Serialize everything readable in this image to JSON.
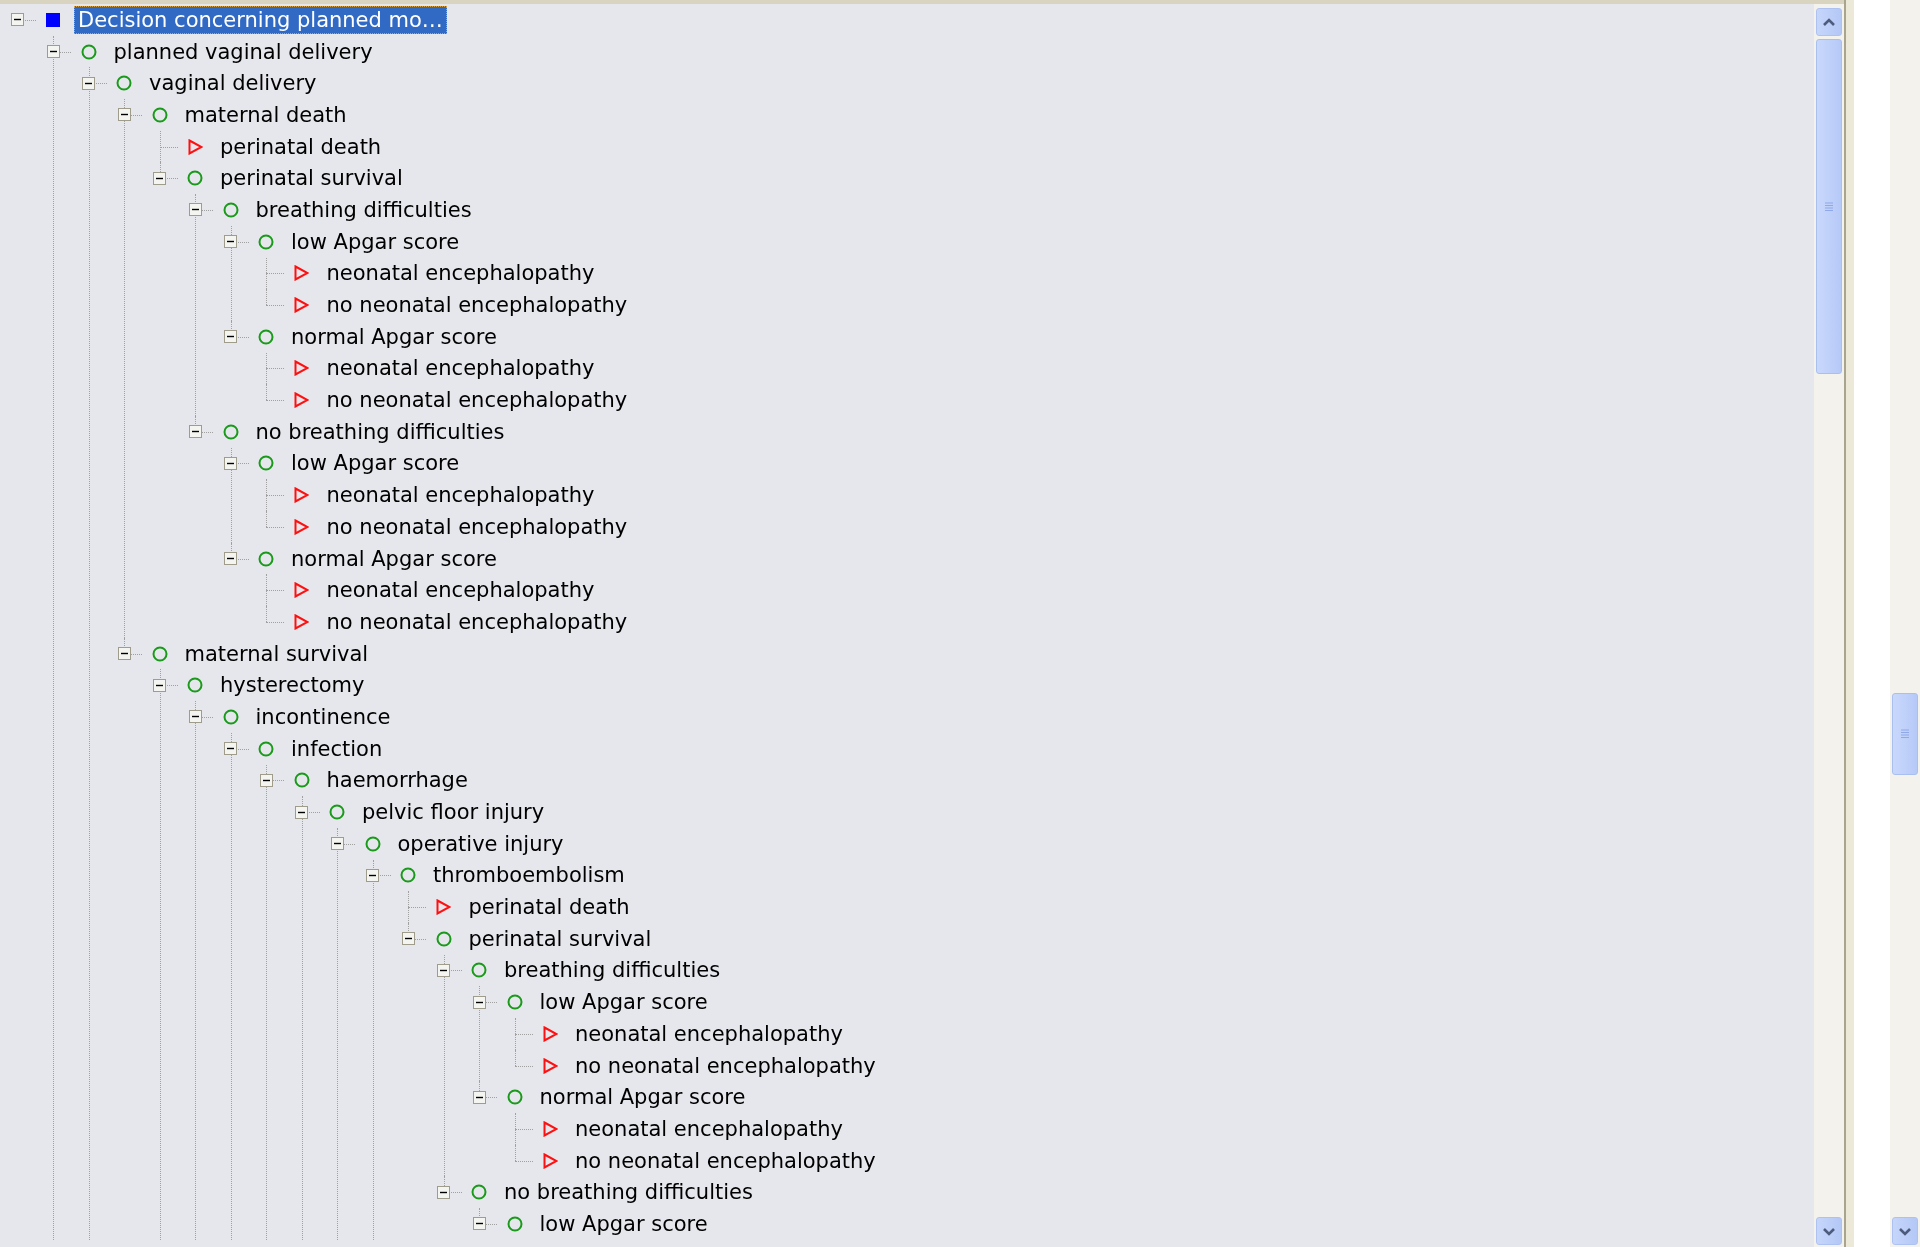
{
  "tree": {
    "root": {
      "label": "Decision concerning planned mo…",
      "kind": "decision",
      "selected": true,
      "expanded": true,
      "children": [
        {
          "label": "planned vaginal delivery",
          "kind": "chance",
          "selected": false,
          "expanded": true,
          "more_siblings_below": true,
          "children": [
            {
              "label": "vaginal delivery",
              "kind": "chance",
              "selected": false,
              "expanded": true,
              "more_siblings_below": true,
              "children": [
                {
                  "label": "maternal death",
                  "kind": "chance",
                  "selected": false,
                  "expanded": true,
                  "children": [
                    {
                      "label": "perinatal death",
                      "kind": "terminal",
                      "selected": false
                    },
                    {
                      "label": "perinatal survival",
                      "kind": "chance",
                      "selected": false,
                      "expanded": true,
                      "children": [
                        {
                          "label": "breathing difficulties",
                          "kind": "chance",
                          "selected": false,
                          "expanded": true,
                          "children": [
                            {
                              "label": "low Apgar score",
                              "kind": "chance",
                              "selected": false,
                              "expanded": true,
                              "children": [
                                {
                                  "label": "neonatal encephalopathy",
                                  "kind": "terminal",
                                  "selected": false
                                },
                                {
                                  "label": "no neonatal encephalopathy",
                                  "kind": "terminal",
                                  "selected": false
                                }
                              ]
                            },
                            {
                              "label": "normal Apgar score",
                              "kind": "chance",
                              "selected": false,
                              "expanded": true,
                              "children": [
                                {
                                  "label": "neonatal encephalopathy",
                                  "kind": "terminal",
                                  "selected": false
                                },
                                {
                                  "label": "no neonatal encephalopathy",
                                  "kind": "terminal",
                                  "selected": false
                                }
                              ]
                            }
                          ]
                        },
                        {
                          "label": "no breathing difficulties",
                          "kind": "chance",
                          "selected": false,
                          "expanded": true,
                          "children": [
                            {
                              "label": "low Apgar score",
                              "kind": "chance",
                              "selected": false,
                              "expanded": true,
                              "children": [
                                {
                                  "label": "neonatal encephalopathy",
                                  "kind": "terminal",
                                  "selected": false
                                },
                                {
                                  "label": "no neonatal encephalopathy",
                                  "kind": "terminal",
                                  "selected": false
                                }
                              ]
                            },
                            {
                              "label": "normal Apgar score",
                              "kind": "chance",
                              "selected": false,
                              "expanded": true,
                              "children": [
                                {
                                  "label": "neonatal encephalopathy",
                                  "kind": "terminal",
                                  "selected": false
                                },
                                {
                                  "label": "no neonatal encephalopathy",
                                  "kind": "terminal",
                                  "selected": false
                                }
                              ]
                            }
                          ]
                        }
                      ]
                    }
                  ]
                },
                {
                  "label": "maternal survival",
                  "kind": "chance",
                  "selected": false,
                  "expanded": true,
                  "children": [
                    {
                      "label": "hysterectomy",
                      "kind": "chance",
                      "selected": false,
                      "expanded": true,
                      "more_siblings_below": true,
                      "children": [
                        {
                          "label": "incontinence",
                          "kind": "chance",
                          "selected": false,
                          "expanded": true,
                          "more_siblings_below": true,
                          "children": [
                            {
                              "label": "infection",
                              "kind": "chance",
                              "selected": false,
                              "expanded": true,
                              "more_siblings_below": true,
                              "children": [
                                {
                                  "label": "haemorrhage",
                                  "kind": "chance",
                                  "selected": false,
                                  "expanded": true,
                                  "more_siblings_below": true,
                                  "children": [
                                    {
                                      "label": "pelvic floor injury",
                                      "kind": "chance",
                                      "selected": false,
                                      "expanded": true,
                                      "more_siblings_below": true,
                                      "children": [
                                        {
                                          "label": "operative injury",
                                          "kind": "chance",
                                          "selected": false,
                                          "expanded": true,
                                          "more_siblings_below": true,
                                          "children": [
                                            {
                                              "label": "thromboembolism",
                                              "kind": "chance",
                                              "selected": false,
                                              "expanded": true,
                                              "more_siblings_below": true,
                                              "children": [
                                                {
                                                  "label": "perinatal death",
                                                  "kind": "terminal",
                                                  "selected": false
                                                },
                                                {
                                                  "label": "perinatal survival",
                                                  "kind": "chance",
                                                  "selected": false,
                                                  "expanded": true,
                                                  "children": [
                                                    {
                                                      "label": "breathing difficulties",
                                                      "kind": "chance",
                                                      "selected": false,
                                                      "expanded": true,
                                                      "children": [
                                                        {
                                                          "label": "low Apgar score",
                                                          "kind": "chance",
                                                          "selected": false,
                                                          "expanded": true,
                                                          "children": [
                                                            {
                                                              "label": "neonatal encephalopathy",
                                                              "kind": "terminal",
                                                              "selected": false
                                                            },
                                                            {
                                                              "label": "no neonatal encephalopathy",
                                                              "kind": "terminal",
                                                              "selected": false
                                                            }
                                                          ]
                                                        },
                                                        {
                                                          "label": "normal Apgar score",
                                                          "kind": "chance",
                                                          "selected": false,
                                                          "expanded": true,
                                                          "children": [
                                                            {
                                                              "label": "neonatal encephalopathy",
                                                              "kind": "terminal",
                                                              "selected": false
                                                            },
                                                            {
                                                              "label": "no neonatal encephalopathy",
                                                              "kind": "terminal",
                                                              "selected": false
                                                            }
                                                          ]
                                                        }
                                                      ]
                                                    },
                                                    {
                                                      "label": "no breathing difficulties",
                                                      "kind": "chance",
                                                      "selected": false,
                                                      "expanded": true,
                                                      "children": [
                                                        {
                                                          "label": "low Apgar score",
                                                          "kind": "chance",
                                                          "selected": false,
                                                          "expanded": true
                                                        }
                                                      ]
                                                    }
                                                  ]
                                                }
                                              ]
                                            }
                                          ]
                                        }
                                      ]
                                    }
                                  ]
                                }
                              ]
                            }
                          ]
                        }
                      ]
                    }
                  ]
                }
              ]
            }
          ]
        }
      ]
    }
  }
}
